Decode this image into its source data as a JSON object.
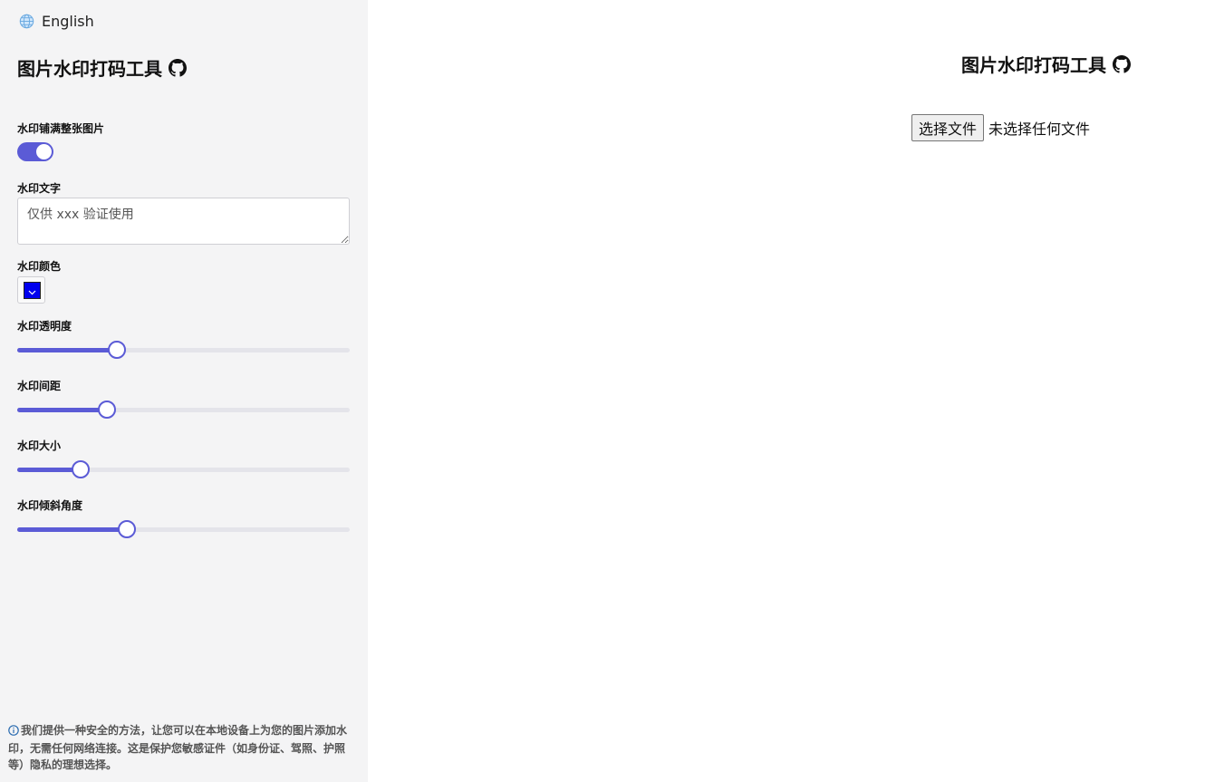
{
  "language": {
    "label": "English",
    "icon": "globe-icon"
  },
  "sidebar": {
    "title": "图片水印打码工具",
    "title_icon": "github-icon",
    "fill_label": "水印铺满整张图片",
    "fill_enabled": true,
    "text_label": "水印文字",
    "text_placeholder": "仅供 xxx 验证使用",
    "color_label": "水印颜色",
    "color_value": "#0000ee",
    "sliders": [
      {
        "label": "水印透明度",
        "value": 0.3
      },
      {
        "label": "水印间距",
        "value": 0.27
      },
      {
        "label": "水印大小",
        "value": 0.19
      },
      {
        "label": "水印倾斜角度",
        "value": 0.33
      }
    ],
    "privacy_note": "我们提供一种安全的方法，让您可以在本地设备上为您的图片添加水印，无需任何网络连接。这是保护您敏感证件（如身份证、驾照、护照等）隐私的理想选择。"
  },
  "main": {
    "title": "图片水印打码工具",
    "file_button": "选择文件",
    "file_status": "未选择任何文件"
  },
  "colors": {
    "accent": "#5b5bd6",
    "sidebar_bg": "#f4f4f5",
    "track": "#e4e4ea"
  }
}
